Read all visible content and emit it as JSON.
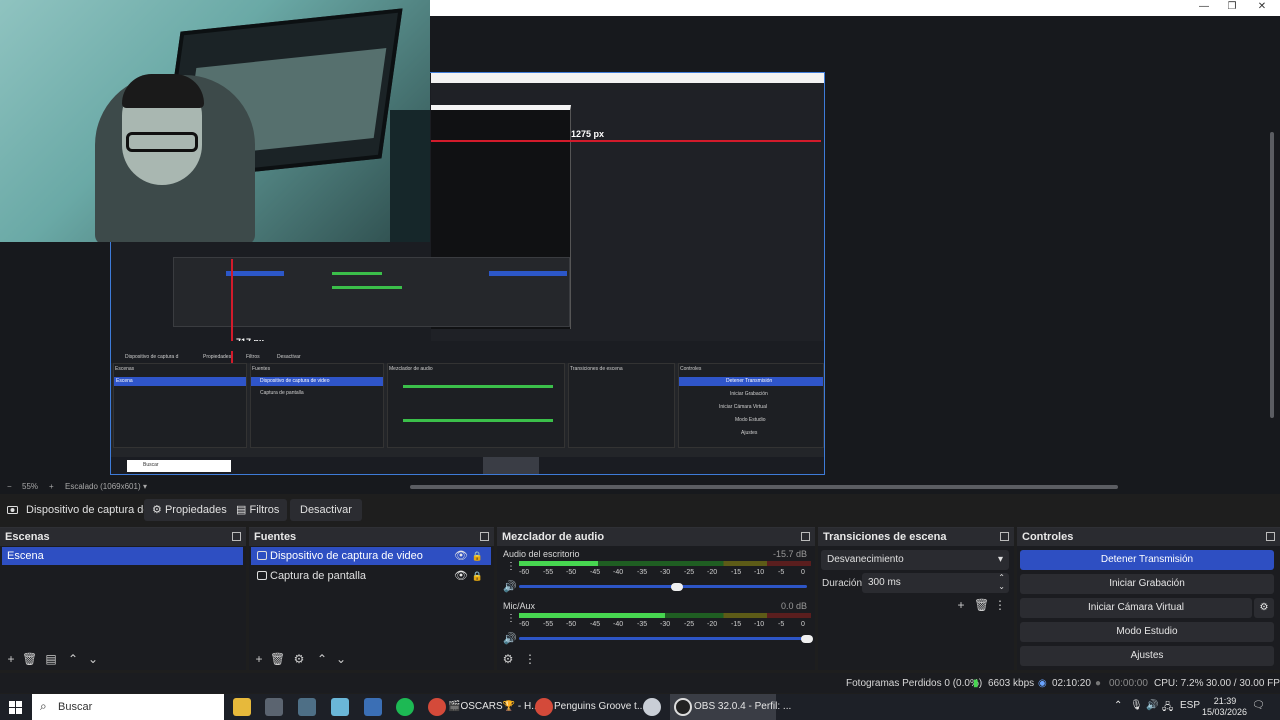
{
  "window": {
    "minimize": "—",
    "maximize": "❐",
    "close": "✕"
  },
  "preview": {
    "measure_width": "1275 px",
    "measure_height": "717 px",
    "zoom": "55%",
    "zoom_minus": "−",
    "zoom_plus": "+",
    "scale_label": "Escalado (1069x601)"
  },
  "inner_capture": {
    "search": "Buscar",
    "source_toolbar": [
      "Dispositivo de captura d",
      "Propiedades",
      "Filtros",
      "Desactivar"
    ],
    "panels": [
      "Escenas",
      "Fuentes",
      "Mezclador de audio",
      "Transiciones de escena",
      "Controles"
    ],
    "scene": "Escena",
    "sources": [
      "Dispositivo de captura de video",
      "Captura de pantalla"
    ],
    "controls": [
      "Detener Transmisión",
      "Iniciar Grabación",
      "Iniciar Cámara Virtual",
      "Modo Estudio",
      "Ajustes"
    ]
  },
  "source_toolbar": {
    "source_name": "Dispositivo de captura de v",
    "properties": "Propiedades",
    "filters": "Filtros",
    "deactivate": "Desactivar"
  },
  "scenes": {
    "title": "Escenas",
    "items": [
      "Escena"
    ]
  },
  "sources": {
    "title": "Fuentes",
    "items": [
      {
        "label": "Dispositivo de captura de video",
        "selected": true,
        "icon": "camera-icon"
      },
      {
        "label": "Captura de pantalla",
        "selected": false,
        "icon": "monitor-icon"
      }
    ]
  },
  "mixer": {
    "title": "Mezclador de audio",
    "channels": [
      {
        "name": "Audio del escritorio",
        "db": "-15.7 dB",
        "level": 0.27,
        "fader": 0.55
      },
      {
        "name": "Mic/Aux",
        "db": "0.0 dB",
        "level": 0.5,
        "fader": 1.0
      }
    ],
    "scale": [
      "-60",
      "-55",
      "-50",
      "-45",
      "-40",
      "-35",
      "-30",
      "-25",
      "-20",
      "-15",
      "-10",
      "-5",
      "0"
    ]
  },
  "transitions": {
    "title": "Transiciones de escena",
    "selected": "Desvanecimiento",
    "duration_label": "Duración",
    "duration_value": "300 ms"
  },
  "controls": {
    "title": "Controles",
    "stop_stream": "Detener Transmisión",
    "start_recording": "Iniciar Grabación",
    "start_virtual_cam": "Iniciar Cámara Virtual",
    "studio_mode": "Modo Estudio",
    "settings": "Ajustes"
  },
  "status": {
    "dropped_frames": "Fotogramas Perdidos 0 (0.0%)",
    "bitrate": "6603 kbps",
    "stream_time": "02:10:20",
    "record_time": "00:00:00",
    "cpu": "CPU: 7.2%",
    "fps": "30.00 / 30.00 FPS"
  },
  "taskbar": {
    "search": "Buscar",
    "apps": [
      {
        "label": "🎬OSCARS🏆 - H..."
      },
      {
        "label": "Penguins Groove t..."
      },
      {
        "label": "OBS 32.0.4 - Perfil: ..."
      }
    ],
    "lang": "ESP",
    "time": "21:39",
    "date": "15/03/2026"
  },
  "colors": {
    "accent": "#2e4fc2",
    "meter_green": "#47d650",
    "measure_red": "#d21b2b"
  }
}
